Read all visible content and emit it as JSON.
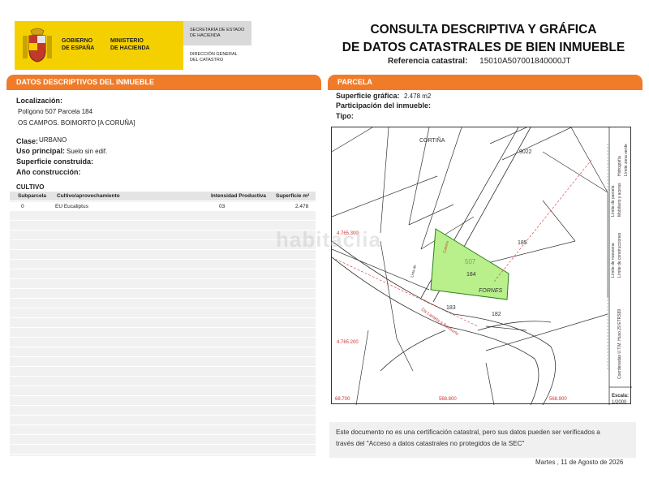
{
  "header": {
    "gov_line1": "GOBIERNO",
    "gov_line2": "DE ESPAÑA",
    "min_line1": "MINISTERIO",
    "min_line2": "DE HACIENDA",
    "sec_line1": "SECRETARÍA DE ESTADO",
    "sec_line2": "DE HACIENDA",
    "dg_line1": "DIRECCIÓN GENERAL",
    "dg_line2": "DEL CATASTRO",
    "title_line1": "CONSULTA DESCRIPTIVA Y GRÁFICA",
    "title_line2": "DE DATOS CATASTRALES DE BIEN INMUEBLE",
    "ref_label": "Referencia catastral:",
    "ref_value": "15010A507001840000JT"
  },
  "left": {
    "section_title": "DATOS DESCRIPTIVOS DEL INMUEBLE",
    "localizacion_label": "Localización:",
    "localizacion_line1": "Polígono 507 Parcela 184",
    "localizacion_line2": "OS CAMPOS. BOIMORTO [A CORUÑA]",
    "clase_label": "Clase:",
    "clase_value": "URBANO",
    "uso_label": "Uso principal:",
    "uso_value": "Suelo sin edif.",
    "sup_construida_label": "Superficie construida:",
    "anio_label": "Año construcción:",
    "cultivo_title": "CULTIVO",
    "table_headers": [
      "Subparcela",
      "Cultivo/aprovechamiento",
      "Intensidad Productiva",
      "Superficie m²"
    ],
    "table_rows": [
      [
        "0",
        "EU Eucaliptus",
        "03",
        "2.478"
      ]
    ]
  },
  "right": {
    "section_title": "PARCELA",
    "sup_grafica_label": "Superficie gráfica:",
    "sup_grafica_value": "2.478 m2",
    "participacion_label": "Participación del inmueble:",
    "tipo_label": "Tipo:",
    "map": {
      "labels": {
        "cortina": "CORTIÑA",
        "fornes": "FORNES",
        "p9022": "9022",
        "p185": "185",
        "p507": "507",
        "p184": "184",
        "p183": "183",
        "p182": "182",
        "road_label": "Da Lamela a Boimorto",
        "lista": "Lista de",
        "camino": "Camino",
        "y_top": "4.765.300",
        "y_bottom": "4.765.200",
        "x_left": "68.700",
        "x_mid": "568.800",
        "x_right": "568.900",
        "legend_items": [
          "Hidrografía",
          "Límite zona verde",
          "Límite de parcela",
          "Mobiliario y aceras",
          "Límite de manzana",
          "Límite de construcciones"
        ],
        "coords_system": "Coordenadas U.T.M. Huso 29 ETRS89",
        "scale_label": "Escala:",
        "scale_value": "1/2000"
      },
      "colors": {
        "parcel_fill": "#b9f08c",
        "parcel_stroke": "#2e7d1a",
        "road_dashed": "#d33"
      }
    }
  },
  "footer": {
    "note_line1": "Este documento no es una certificación catastral, pero sus datos pueden ser verificados a",
    "note_line2": "través del \"Acceso a datos catastrales no protegidos de la SEC\"",
    "date": "Martes , 11 de Agosto de 2026"
  },
  "watermark": "habitaclia"
}
